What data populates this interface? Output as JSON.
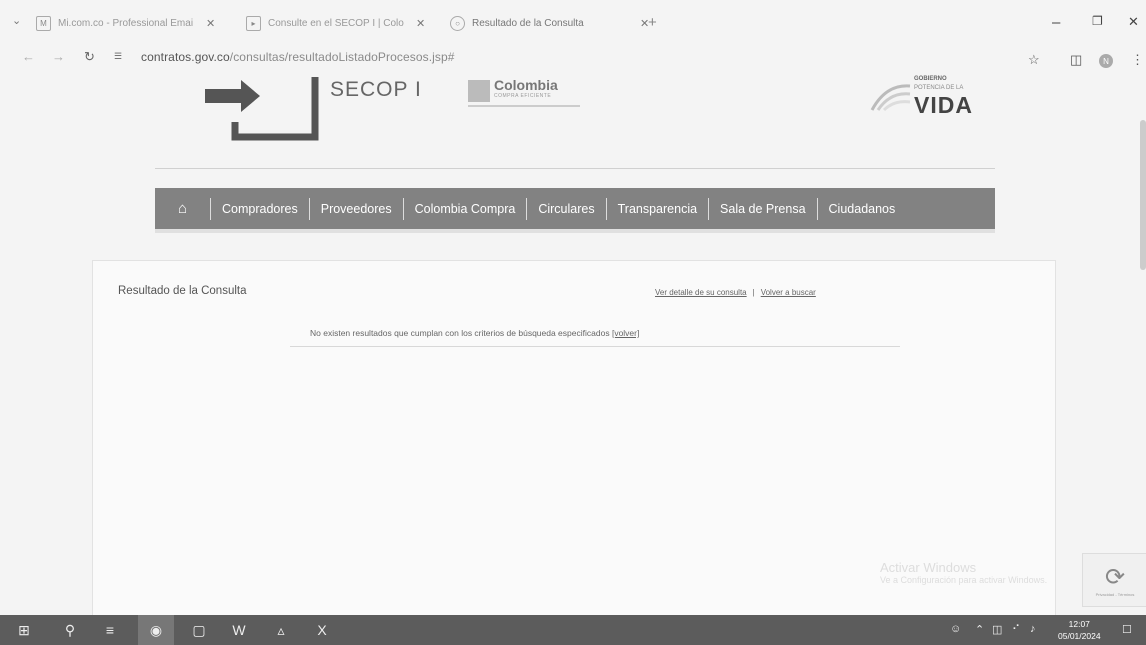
{
  "browser": {
    "tabs": [
      {
        "title": "Mi.com.co - Professional Emai",
        "icon": "mail-favicon",
        "active": false
      },
      {
        "title": "Consulte en el SECOP I | Colo",
        "icon": "secop-favicon",
        "active": false
      },
      {
        "title": "Resultado de la Consulta",
        "icon": "globe-favicon",
        "active": true
      }
    ],
    "new_tab": "+",
    "url_host": "contratos.gov.co",
    "url_path": "/consultas/resultadoListadoProcesos.jsp#",
    "profile_initial": "N"
  },
  "header": {
    "secop_label": "SECOP I",
    "cc_name": "Colombia",
    "cc_sub": "COMPRA EFICIENTE",
    "gov_top": "GOBIERNO",
    "gov_mid": "POTENCIA DE LA",
    "gov_vida": "VIDA"
  },
  "nav": {
    "home_icon": "home-icon",
    "items": [
      "Compradores",
      "Proveedores",
      "Colombia Compra",
      "Circulares",
      "Transparencia",
      "Sala de Prensa",
      "Ciudadanos"
    ]
  },
  "results": {
    "title": "Resultado de la Consulta",
    "link_details": "Ver detalle de su consulta",
    "link_separator": "|",
    "link_back": "Volver a buscar",
    "no_results": "No existen resultados que cumplan con los criterios de búsqueda especificados",
    "back_link": "[volver]"
  },
  "overlay": {
    "watermark_title": "Activar Windows",
    "watermark_sub": "Ve a Configuración para activar Windows.",
    "recaptcha_text": "Privacidad - Términos"
  },
  "taskbar": {
    "time": "12:07",
    "date": "05/01/2024"
  },
  "colors": {
    "nav_bg": "#828282",
    "taskbar_bg": "#5c5c5c"
  }
}
